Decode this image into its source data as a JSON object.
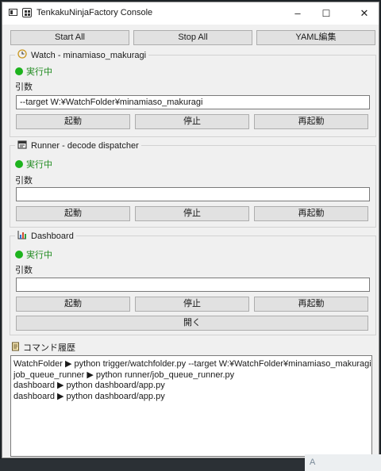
{
  "window": {
    "title": "TenkakuNinjaFactory Console",
    "minimize": "–",
    "maximize": "☐",
    "close": "✕"
  },
  "toolbar": {
    "start_all": "Start All",
    "stop_all": "Stop All",
    "yaml_edit": "YAML編集"
  },
  "watch": {
    "title": "Watch - minamiaso_makuragi",
    "status": "実行中",
    "args_label": "引数",
    "args_value": "--target W:¥WatchFolder¥minamiaso_makuragi",
    "start": "起動",
    "stop": "停止",
    "restart": "再起動"
  },
  "runner": {
    "title": "Runner - decode dispatcher",
    "status": "実行中",
    "args_label": "引数",
    "args_value": "",
    "start": "起動",
    "stop": "停止",
    "restart": "再起動"
  },
  "dashboard": {
    "title": "Dashboard",
    "status": "実行中",
    "args_label": "引数",
    "args_value": "",
    "start": "起動",
    "stop": "停止",
    "restart": "再起動",
    "open": "開く"
  },
  "history": {
    "label": "コマンド履歴",
    "lines": [
      "WatchFolder ▶ python trigger/watchfolder.py --target W:¥WatchFolder¥minamiaso_makuragi",
      "job_queue_runner ▶ python runner/job_queue_runner.py",
      "dashboard ▶ python dashboard/app.py",
      "dashboard ▶ python dashboard/app.py"
    ]
  },
  "tray": {
    "text": "A"
  },
  "colors": {
    "status_green": "#1db31d",
    "status_text": "#1e8a1e"
  }
}
